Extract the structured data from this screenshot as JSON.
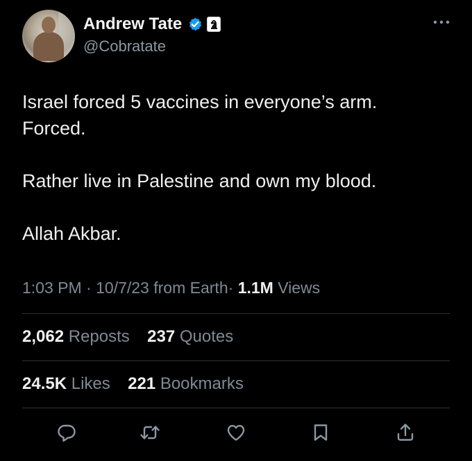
{
  "tweet": {
    "author": {
      "name": "Andrew Tate",
      "handle": "@Cobratate",
      "verified_color": "#1d9bf0"
    },
    "text_paragraphs": [
      [
        "Israel forced 5 vaccines in everyone’s arm.",
        "Forced."
      ],
      [
        "Rather live in Palestine and own my blood."
      ],
      [
        "Allah Akbar."
      ]
    ],
    "meta": {
      "time": "1:03 PM",
      "sep1": "·",
      "date": "10/7/23",
      "source": "from Earth",
      "sep2": "·",
      "views_count": "1.1M",
      "views_label": "Views"
    },
    "stats_row1": {
      "reposts_count": "2,062",
      "reposts_label": "Reposts",
      "quotes_count": "237",
      "quotes_label": "Quotes"
    },
    "stats_row2": {
      "likes_count": "24.5K",
      "likes_label": "Likes",
      "bookmarks_count": "221",
      "bookmarks_label": "Bookmarks"
    },
    "actions": [
      "reply-icon",
      "repost-icon",
      "like-icon",
      "bookmark-icon",
      "share-icon"
    ],
    "colors": {
      "background": "#000000",
      "text": "#e7e9ea",
      "secondary": "#8b98a5",
      "divider": "#2f3336"
    }
  }
}
